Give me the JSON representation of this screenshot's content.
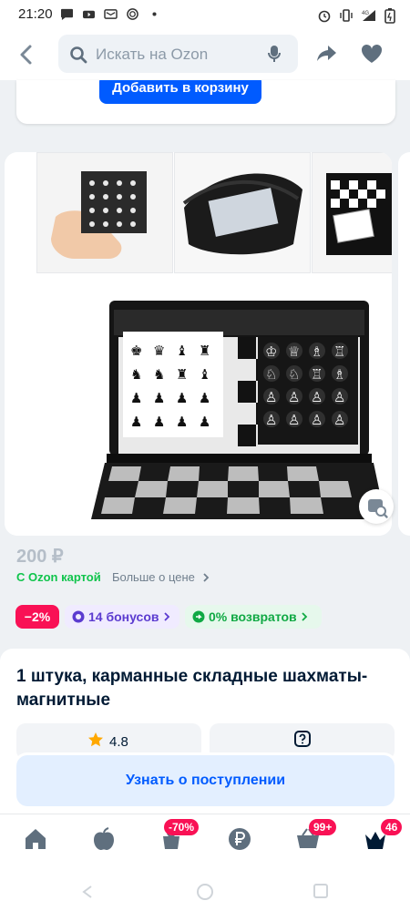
{
  "status_bar": {
    "time": "21:20",
    "network": "4G"
  },
  "header": {
    "search_placeholder": "Искать на Ozon"
  },
  "top_card": {
    "add_to_cart_label": "Добавить в корзину"
  },
  "product": {
    "price": "200 ₽",
    "ozon_card_label": "С Ozon картой",
    "more_price_label": "Больше о цене",
    "chips": {
      "discount": "−2%",
      "bonuses": "14 бонусов",
      "returns": "0% возвратов"
    },
    "title": "1 штука, карманные складные шахматы-магнитные",
    "rating": "4.8",
    "notify_button_label": "Узнать о поступлении"
  },
  "bottom_nav": {
    "items": [
      {
        "name": "home",
        "icon": "home-icon"
      },
      {
        "name": "fresh",
        "icon": "apple-icon"
      },
      {
        "name": "sale",
        "icon": "sale-icon",
        "badge": "-70%"
      },
      {
        "name": "finance",
        "icon": "ruble-icon"
      },
      {
        "name": "cart",
        "icon": "cart-icon",
        "badge": "99+"
      },
      {
        "name": "profile",
        "icon": "crown-avatar-icon",
        "badge": "46"
      }
    ]
  },
  "colors": {
    "brand_blue": "#005bff",
    "sale_pink": "#f91155",
    "green": "#10c44c",
    "bonus_purple": "#5b3bd0"
  }
}
